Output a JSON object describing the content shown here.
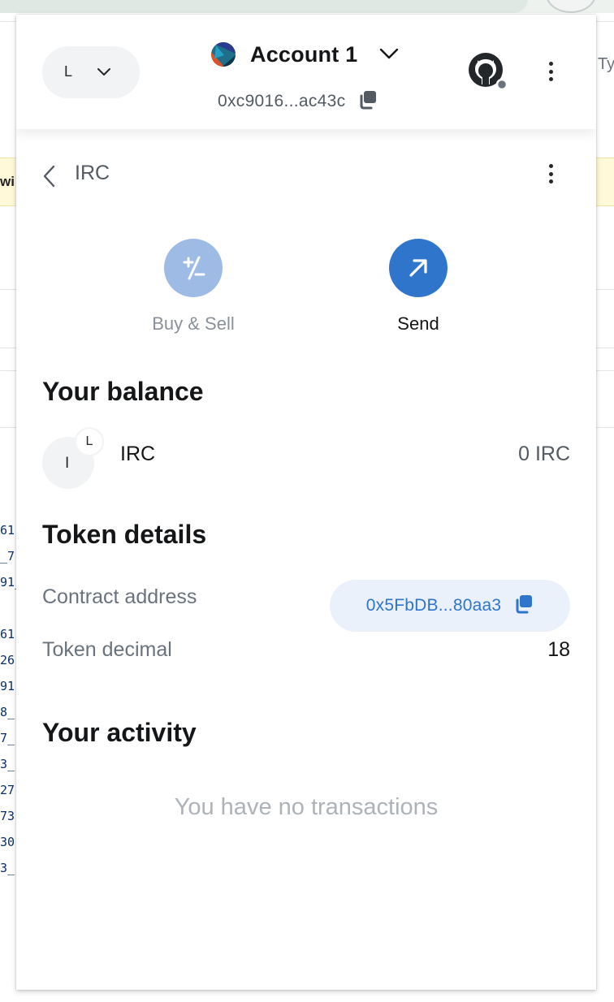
{
  "background": {
    "banner_fragment": "wi",
    "right_fragment": "Ty",
    "code_fragments": [
      "61",
      "_7",
      "91_",
      "61",
      "26",
      "91",
      "8_",
      "7_",
      "3_",
      "27",
      "73",
      "30",
      "3_"
    ]
  },
  "header": {
    "network_letter": "L",
    "account_name": "Account 1",
    "account_address": "0xc9016...ac43c",
    "icons": {
      "network_dropdown": "chevron-down-icon",
      "account_dropdown": "chevron-down-icon",
      "copy": "copy-icon",
      "profile": "github-icon",
      "menu": "kebab-menu-icon"
    }
  },
  "token_bar": {
    "title": "IRC",
    "back_icon": "chevron-left-icon",
    "menu_icon": "kebab-menu-icon"
  },
  "actions": {
    "buy_sell_label": "Buy & Sell",
    "send_label": "Send"
  },
  "balance": {
    "title": "Your balance",
    "token_symbol": "IRC",
    "token_letter": "I",
    "network_badge_letter": "L",
    "amount": "0 IRC"
  },
  "token_details": {
    "title": "Token details",
    "contract_label": "Contract address",
    "contract_value": "0x5FbDB...80aa3",
    "decimal_label": "Token decimal",
    "decimal_value": "18"
  },
  "activity": {
    "title": "Your activity",
    "empty_text": "You have no transactions"
  },
  "colors": {
    "primary": "#2f75cc",
    "primary_muted": "#9dbbe5",
    "pill_background": "#eaf1fb",
    "text_default": "#141618",
    "text_alternative": "#6a737d",
    "text_muted": "#aeb3b9"
  }
}
